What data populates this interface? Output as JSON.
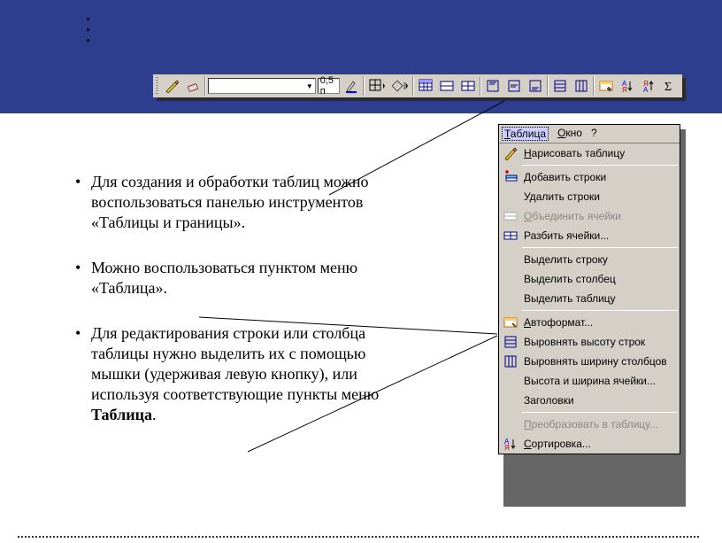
{
  "toolbar": {
    "line_width": "0,5 п"
  },
  "body": {
    "p1": "Для создания и обработки таблиц можно воспользоваться панелью инструментов «Таблицы и границы».",
    "p2": "Можно воспользоваться пунктом меню «Таблица».",
    "p3a": "Для редактирования строки или столбца таблицы нужно выделить их с помощью мышки (удерживая левую кнопку), или используя соответствующие пункты меню ",
    "p3b": "Таблица",
    "p3c": "."
  },
  "menu": {
    "bar": {
      "table": "Таблица",
      "window": "Окно",
      "help": "?"
    },
    "items": {
      "draw": "Нарисовать таблицу",
      "add_rows": "Добавить строки",
      "del_rows": "Удалить строки",
      "merge": "Объединить ячейки",
      "split": "Разбить ячейки...",
      "sel_row": "Выделить строку",
      "sel_col": "Выделить столбец",
      "sel_table": "Выделить таблицу",
      "autoformat": "Автоформат...",
      "even_h": "Выровнять высоту строк",
      "even_w": "Выровнять ширину столбцов",
      "size": "Высота и ширина ячейки...",
      "headers": "Заголовки",
      "convert": "Преобразовать в таблицу...",
      "sort": "Сортировка..."
    }
  }
}
